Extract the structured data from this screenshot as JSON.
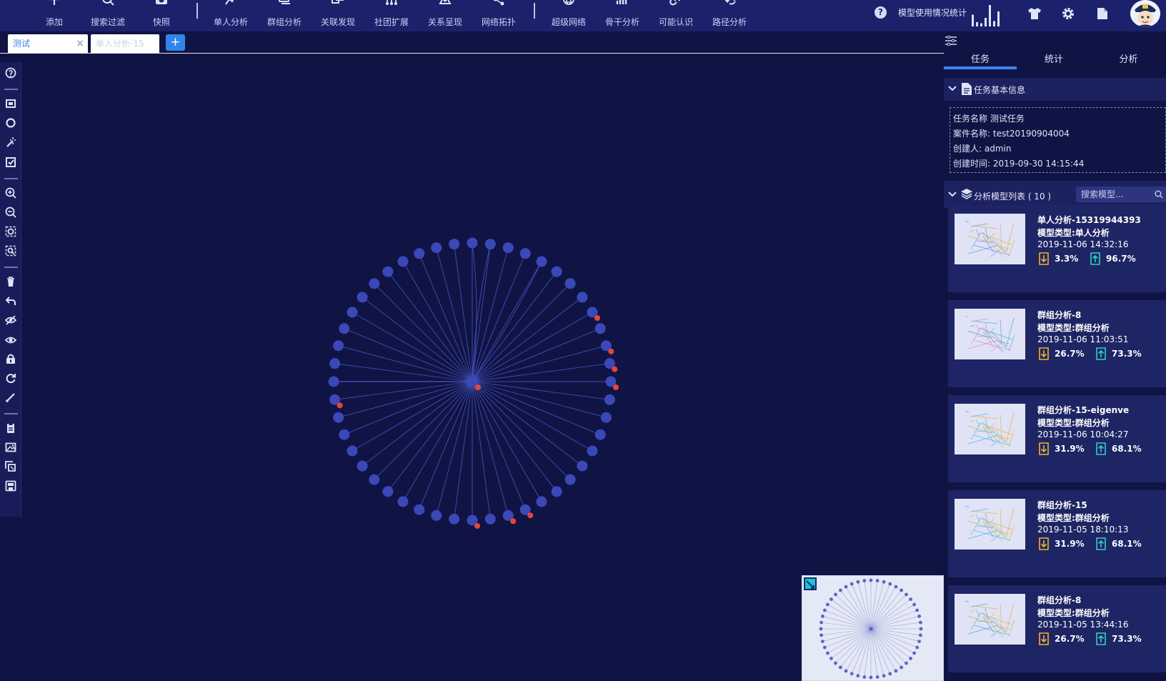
{
  "toolbar": {
    "items": [
      {
        "label": "添加",
        "icon": "plus-icon"
      },
      {
        "label": "搜索过滤",
        "icon": "search-icon"
      },
      {
        "label": "快照",
        "icon": "camera-icon"
      },
      {
        "label": "单人分析",
        "icon": "person-analysis-icon"
      },
      {
        "label": "群组分析",
        "icon": "group-analysis-icon"
      },
      {
        "label": "关联发现",
        "icon": "link-discovery-icon"
      },
      {
        "label": "社团扩展",
        "icon": "community-tree-icon"
      },
      {
        "label": "关系呈现",
        "icon": "relation-triangle-icon"
      },
      {
        "label": "网络拓扑",
        "icon": "network-topology-icon"
      },
      {
        "label": "超级网络",
        "icon": "globe-icon"
      },
      {
        "label": "骨干分析",
        "icon": "backbone-chart-icon"
      },
      {
        "label": "可能认识",
        "icon": "link-chain-icon"
      },
      {
        "label": "路径分析",
        "icon": "path-pin-icon"
      }
    ],
    "help_symbol": "?",
    "usage_label": "模型使用情况统计",
    "usage_bars": [
      0.55,
      0.2,
      0.15,
      0.4,
      1.0,
      0.25,
      0.7
    ],
    "right_icons": [
      "shirt-icon",
      "gear-icon",
      "document-icon"
    ]
  },
  "tabs": {
    "items": [
      {
        "label": "测试",
        "close": "×"
      },
      {
        "label": "单人分析-15"
      }
    ],
    "add_symbol": "+"
  },
  "left_tools": [
    "help-circle-icon",
    "frame-select-icon",
    "lasso-icon",
    "magic-wand-icon",
    "check-square-icon",
    "zoom-in-icon",
    "zoom-out-icon",
    "fit-view-icon",
    "fit-selection-icon",
    "trash-icon",
    "undo-icon",
    "hide-icon",
    "show-icon",
    "lock-icon",
    "refresh-icon",
    "edit-line-icon",
    "clipboard-icon",
    "image-export-icon",
    "layout-icon",
    "save-image-icon"
  ],
  "graph": {
    "node_count": 48,
    "flagged_nodes": [
      8,
      10,
      11,
      12,
      21,
      22,
      24,
      35,
      48
    ],
    "center_flagged": true,
    "colors": {
      "node": "#3a48b8",
      "edge": "#4a58c8",
      "flag": "#e8443c",
      "background": "#101444"
    }
  },
  "panel": {
    "tabs": [
      "任务",
      "统计",
      "分析"
    ],
    "active_tab": 0,
    "task_info_title": "任务基本信息",
    "task_info": [
      {
        "label": "任务名称",
        "value": "测试任务"
      },
      {
        "label": "案件名称:",
        "value": "test20190904004"
      },
      {
        "label": "创建人:",
        "value": "admin"
      },
      {
        "label": "创建时间:",
        "value": "2019-09-30 14:15:44"
      }
    ],
    "model_list_title": "分析模型列表 ( 10 )",
    "model_search_placeholder": "搜索模型...",
    "models": [
      {
        "name": "单人分析-15319944393",
        "type": "模型类型:单人分析",
        "time": "2019-11-06 14:32:16",
        "down": "3.3%",
        "up": "96.7%"
      },
      {
        "name": "群组分析-8",
        "type": "模型类型:群组分析",
        "time": "2019-11-06 11:03:51",
        "down": "26.7%",
        "up": "73.3%"
      },
      {
        "name": "群组分析-15-eigenve",
        "type": "模型类型:群组分析",
        "time": "2019-11-06 10:04:27",
        "down": "31.9%",
        "up": "68.1%"
      },
      {
        "name": "群组分析-15",
        "type": "模型类型:群组分析",
        "time": "2019-11-05 18:10:13",
        "down": "31.9%",
        "up": "68.1%"
      },
      {
        "name": "群组分析-8",
        "type": "模型类型:群组分析",
        "time": "2019-11-05 13:44:16",
        "down": "26.7%",
        "up": "73.3%"
      }
    ],
    "colors": {
      "down": "#f0b429",
      "up": "#2fd1c0",
      "accent": "#3e82f0"
    }
  }
}
